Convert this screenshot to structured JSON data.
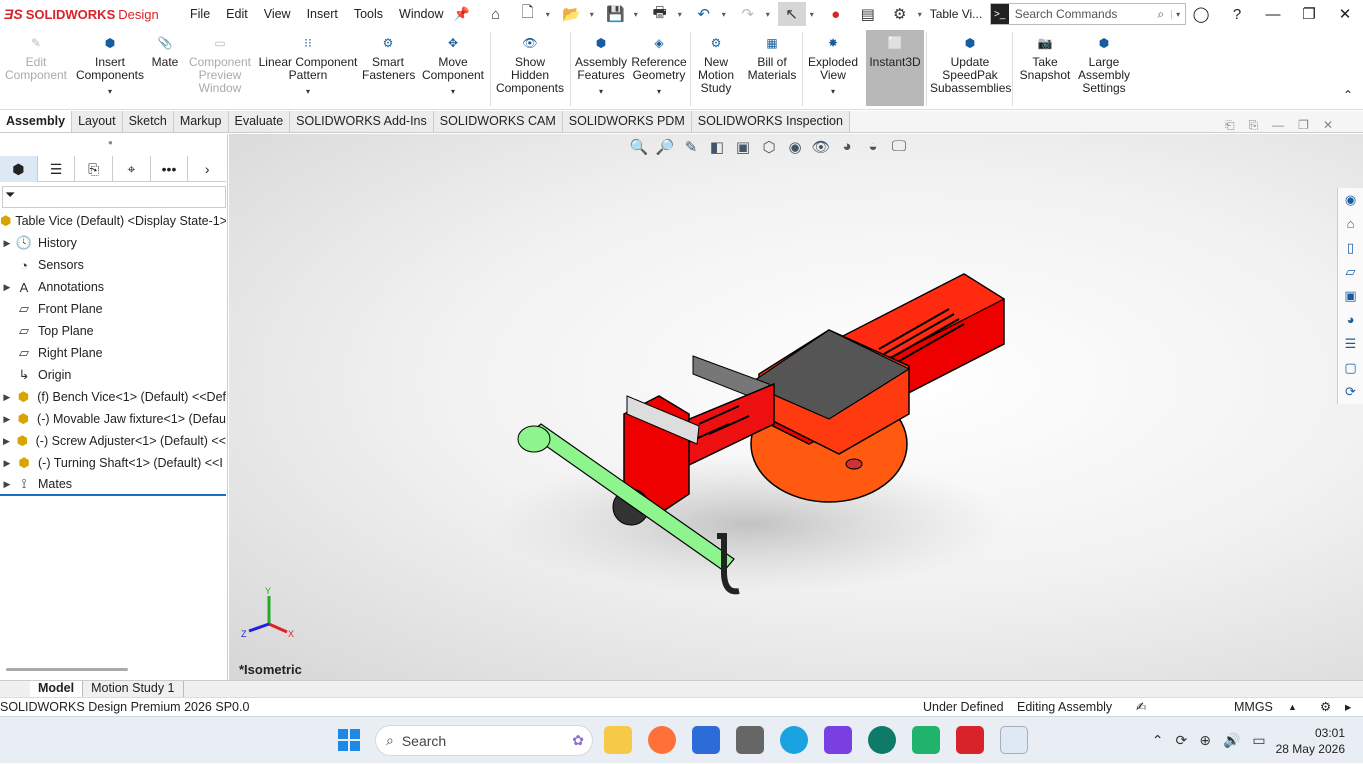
{
  "app": {
    "brand": "SOLIDWORKS",
    "brand_suffix": "Design",
    "doc_title": "Table Vi...",
    "menu": [
      "File",
      "Edit",
      "View",
      "Insert",
      "Tools",
      "Window"
    ],
    "search_placeholder": "Search Commands"
  },
  "ribbon": [
    {
      "label": "Edit\nComponent",
      "disabled": true
    },
    {
      "label": "Insert\nComponents",
      "dropdown": true
    },
    {
      "label": "Mate"
    },
    {
      "label": "Component\nPreview\nWindow",
      "disabled": true
    },
    {
      "label": "Linear Component\nPattern",
      "dropdown": true
    },
    {
      "label": "Smart\nFasteners"
    },
    {
      "label": "Move\nComponent",
      "dropdown": true
    },
    {
      "label": "Show\nHidden\nComponents"
    },
    {
      "label": "Assembly\nFeatures",
      "dropdown": true
    },
    {
      "label": "Reference\nGeometry",
      "dropdown": true
    },
    {
      "label": "New\nMotion\nStudy"
    },
    {
      "label": "Bill of\nMaterials"
    },
    {
      "label": "Exploded\nView",
      "dropdown": true
    },
    {
      "label": "Instant3D",
      "active": true
    },
    {
      "label": "Update\nSpeedPak\nSubassemblies"
    },
    {
      "label": "Take\nSnapshot"
    },
    {
      "label": "Large\nAssembly\nSettings"
    }
  ],
  "tabs": [
    "Assembly",
    "Layout",
    "Sketch",
    "Markup",
    "Evaluate",
    "SOLIDWORKS Add-Ins",
    "SOLIDWORKS CAM",
    "SOLIDWORKS PDM",
    "SOLIDWORKS Inspection"
  ],
  "tree": {
    "root": "Table Vice  (Default) <Display State-1>",
    "items": [
      {
        "label": "History",
        "exp": true,
        "icon": "history-icon"
      },
      {
        "label": "Sensors",
        "exp": false,
        "icon": "sensor-icon"
      },
      {
        "label": "Annotations",
        "exp": true,
        "icon": "annotation-icon"
      },
      {
        "label": "Front Plane",
        "exp": false,
        "icon": "plane-icon"
      },
      {
        "label": "Top Plane",
        "exp": false,
        "icon": "plane-icon"
      },
      {
        "label": "Right Plane",
        "exp": false,
        "icon": "plane-icon"
      },
      {
        "label": "Origin",
        "exp": false,
        "icon": "origin-icon"
      },
      {
        "label": "(f) Bench Vice<1> (Default) <<Def",
        "exp": true,
        "icon": "part-icon"
      },
      {
        "label": "(-) Movable Jaw fixture<1> (Defau",
        "exp": true,
        "icon": "part-icon"
      },
      {
        "label": "(-) Screw Adjuster<1> (Default) <<",
        "exp": true,
        "icon": "part-icon"
      },
      {
        "label": "(-) Turning Shaft<1> (Default) <<I",
        "exp": true,
        "icon": "part-icon"
      },
      {
        "label": "Mates",
        "exp": true,
        "icon": "mates-icon"
      }
    ]
  },
  "viewport": {
    "view_name": "*Isometric"
  },
  "bottom_tabs": [
    "Model",
    "Motion Study 1"
  ],
  "status": {
    "product": "SOLIDWORKS Design Premium 2026 SP0.0",
    "state": "Under Defined",
    "mode": "Editing Assembly",
    "units": "MMGS"
  },
  "taskbar": {
    "search": "Search",
    "time": "03:01",
    "date": "28 May 2026"
  }
}
